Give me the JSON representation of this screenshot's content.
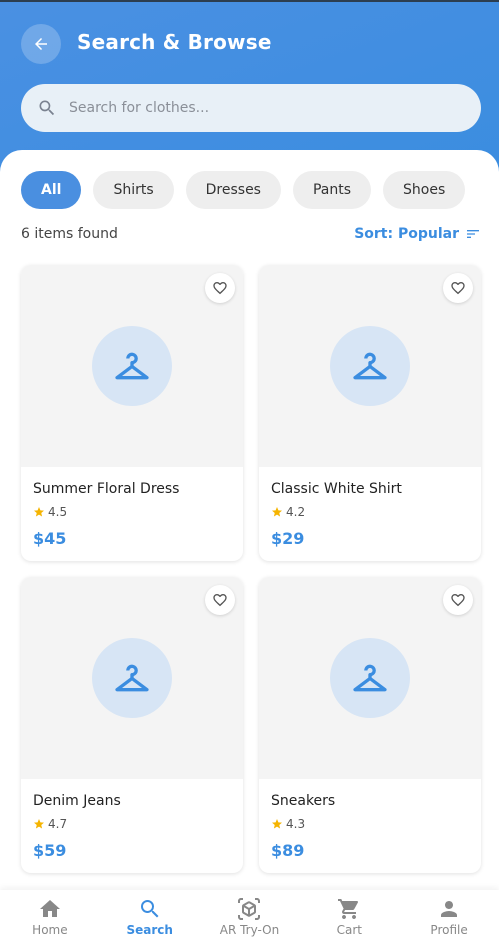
{
  "header": {
    "title": "Search & Browse",
    "back_icon": "arrow-left-icon"
  },
  "search": {
    "placeholder": "Search for clothes...",
    "value": "",
    "icon": "search-icon"
  },
  "filters": {
    "chips": [
      {
        "label": "All",
        "active": true
      },
      {
        "label": "Shirts",
        "active": false
      },
      {
        "label": "Dresses",
        "active": false
      },
      {
        "label": "Pants",
        "active": false
      },
      {
        "label": "Shoes",
        "active": false
      }
    ]
  },
  "results": {
    "count_text": "6 items found",
    "sort_label": "Sort: Popular",
    "sort_icon": "sort-icon"
  },
  "products": [
    {
      "name": "Summer Floral Dress",
      "rating": "4.5",
      "price": "$45",
      "image_icon": "hanger-icon",
      "favorite": false
    },
    {
      "name": "Classic White Shirt",
      "rating": "4.2",
      "price": "$29",
      "image_icon": "hanger-icon",
      "favorite": false
    },
    {
      "name": "Denim Jeans",
      "rating": "4.7",
      "price": "$59",
      "image_icon": "hanger-icon",
      "favorite": false
    },
    {
      "name": "Sneakers",
      "rating": "4.3",
      "price": "$89",
      "image_icon": "hanger-icon",
      "favorite": false
    }
  ],
  "nav": {
    "items": [
      {
        "label": "Home",
        "icon": "home-icon",
        "active": false
      },
      {
        "label": "Search",
        "icon": "search-icon",
        "active": true
      },
      {
        "label": "AR Try-On",
        "icon": "ar-cube-icon",
        "active": false
      },
      {
        "label": "Cart",
        "icon": "cart-icon",
        "active": false
      },
      {
        "label": "Profile",
        "icon": "person-icon",
        "active": false
      }
    ]
  },
  "colors": {
    "primary": "#3b8de0",
    "star": "#f5b400",
    "chip_inactive": "#eeeeee"
  }
}
